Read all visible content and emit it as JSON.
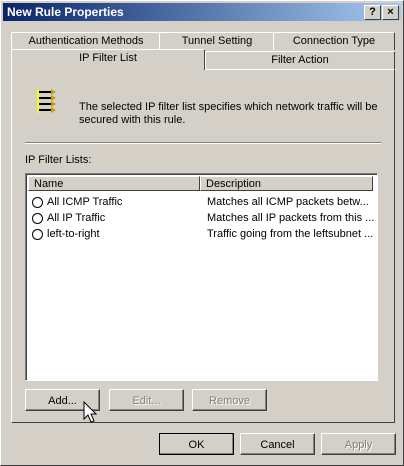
{
  "window": {
    "title": "New Rule Properties"
  },
  "titlebar": {
    "help_label": "?",
    "close_label": "×"
  },
  "tabs_back": [
    {
      "label": "Authentication Methods"
    },
    {
      "label": "Tunnel Setting"
    },
    {
      "label": "Connection Type"
    }
  ],
  "tabs_front": [
    {
      "label": "IP Filter List",
      "active": true
    },
    {
      "label": "Filter Action",
      "active": false
    }
  ],
  "panel": {
    "description": "The selected IP filter list specifies which network traffic will be secured with this rule.",
    "list_label": "IP Filter Lists:",
    "columns": [
      "Name",
      "Description"
    ],
    "rows": [
      {
        "name": "All ICMP Traffic",
        "description": "Matches all ICMP packets betw..."
      },
      {
        "name": "All IP Traffic",
        "description": "Matches all IP packets from this ..."
      },
      {
        "name": "left-to-right",
        "description": "Traffic going from the leftsubnet ..."
      }
    ],
    "buttons": {
      "add": "Add...",
      "edit": "Edit...",
      "remove": "Remove"
    }
  },
  "footer": {
    "ok": "OK",
    "cancel": "Cancel",
    "apply": "Apply"
  },
  "icon": "ip-filter-list-icon"
}
